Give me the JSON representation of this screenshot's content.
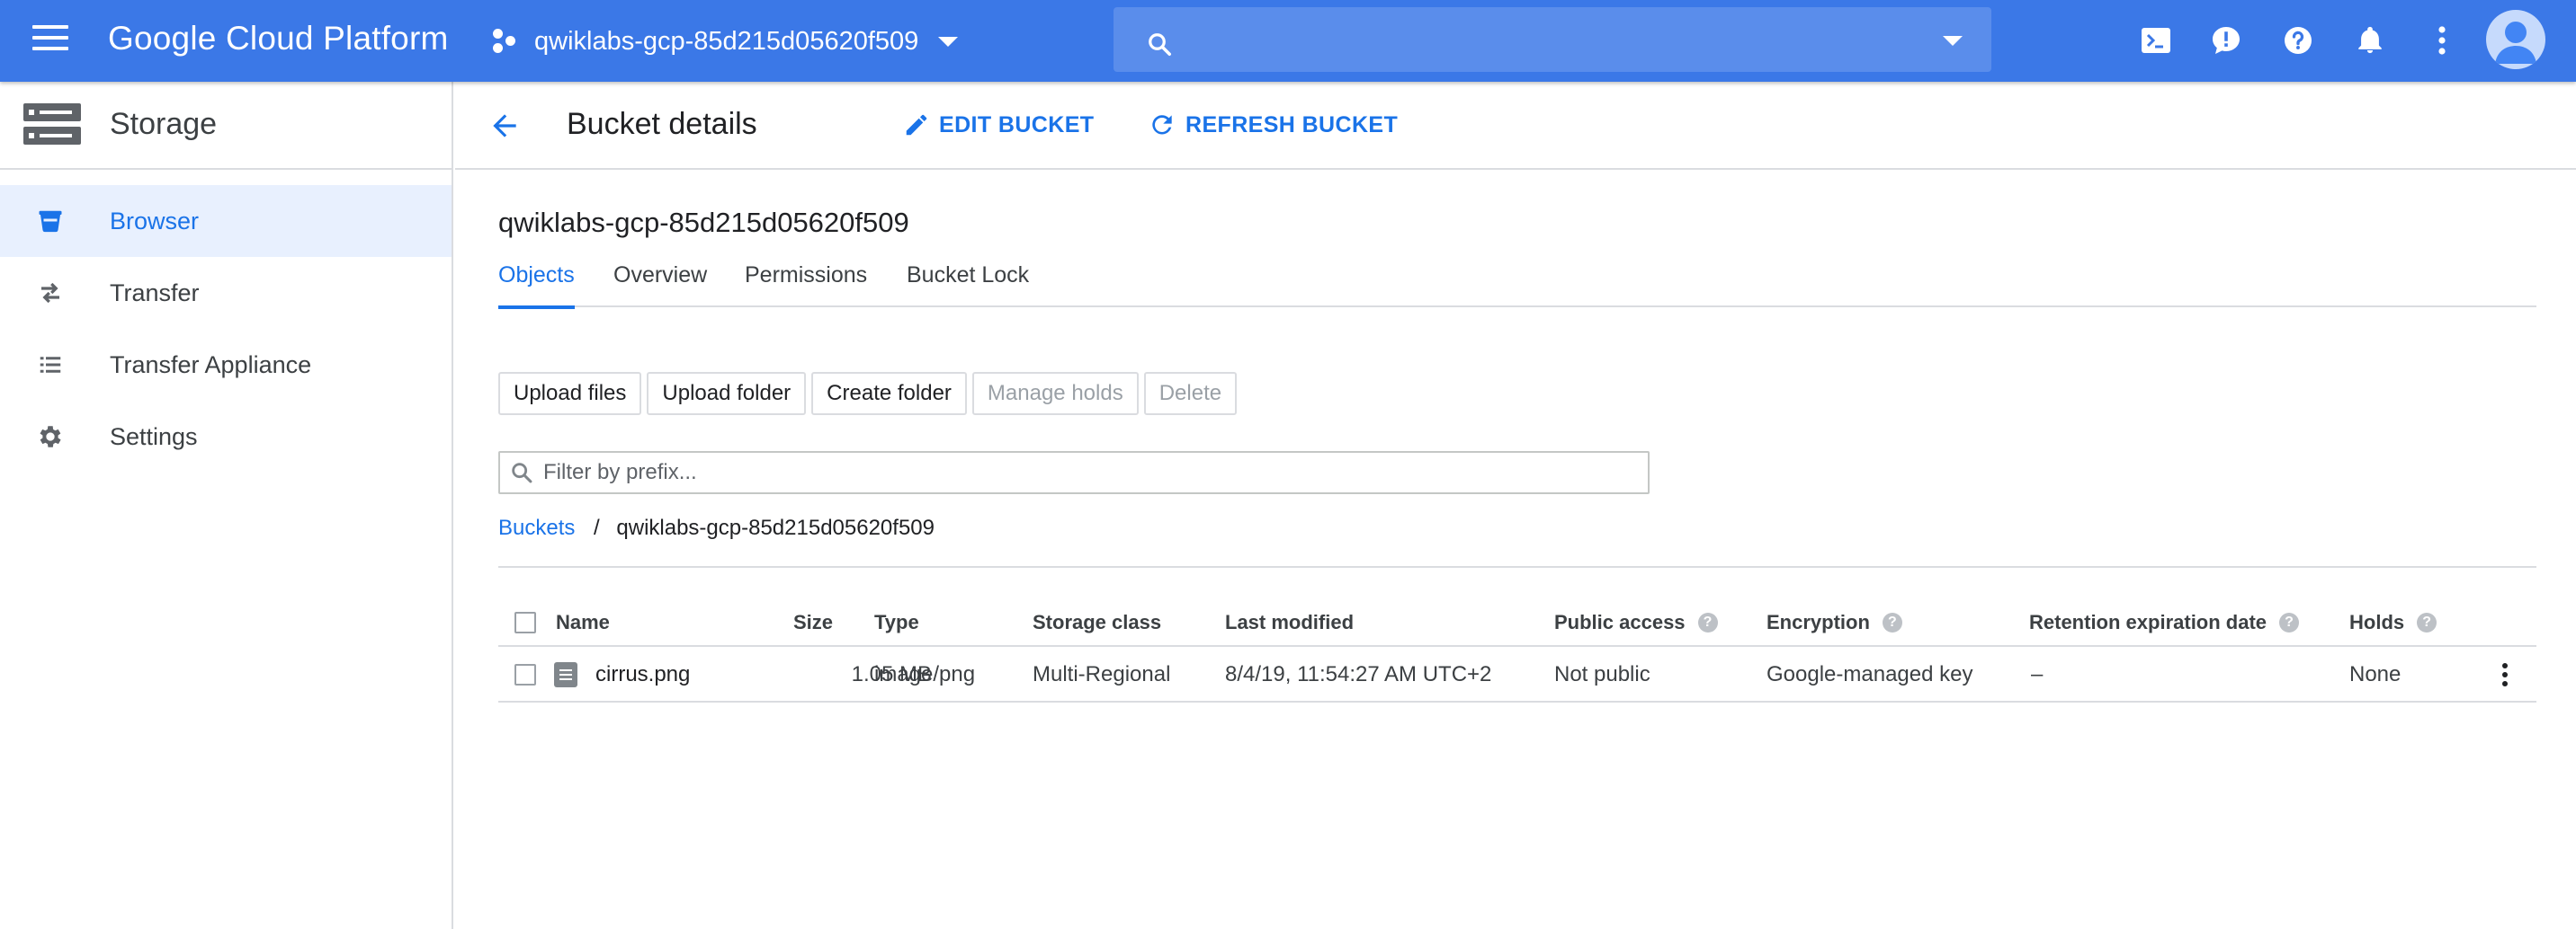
{
  "topbar": {
    "logo": "Google Cloud Platform",
    "project": "qwiklabs-gcp-85d215d05620f509",
    "search_placeholder": "",
    "icons": [
      "menu-icon",
      "project-icon",
      "search-icon",
      "cloud-shell-icon",
      "feedback-icon",
      "help-icon",
      "notifications-icon",
      "more-vert-icon",
      "account-icon"
    ]
  },
  "sidebar": {
    "title": "Storage",
    "items": [
      {
        "label": "Browser",
        "icon": "bucket-icon",
        "active": true
      },
      {
        "label": "Transfer",
        "icon": "transfer-icon"
      },
      {
        "label": "Transfer Appliance",
        "icon": "list-icon"
      },
      {
        "label": "Settings",
        "icon": "gear-icon"
      }
    ]
  },
  "header": {
    "title": "Bucket details",
    "edit_label": "EDIT BUCKET",
    "refresh_label": "REFRESH BUCKET"
  },
  "bucket": {
    "name": "qwiklabs-gcp-85d215d05620f509"
  },
  "tabs": [
    {
      "label": "Objects",
      "active": true
    },
    {
      "label": "Overview"
    },
    {
      "label": "Permissions"
    },
    {
      "label": "Bucket Lock"
    }
  ],
  "actions": {
    "upload_files": "Upload files",
    "upload_folder": "Upload folder",
    "create_folder": "Create folder",
    "manage_holds": "Manage holds",
    "delete": "Delete"
  },
  "filter": {
    "placeholder": "Filter by prefix...",
    "value": ""
  },
  "breadcrumb": {
    "root": "Buckets",
    "separator": "/",
    "current": "qwiklabs-gcp-85d215d05620f509"
  },
  "table": {
    "columns": {
      "name": "Name",
      "size": "Size",
      "type": "Type",
      "storage_class": "Storage class",
      "last_modified": "Last modified",
      "public_access": "Public access",
      "encryption": "Encryption",
      "retention": "Retention expiration date",
      "holds": "Holds"
    },
    "rows": [
      {
        "name": "cirrus.png",
        "size": "1.05 MB",
        "type": "image/png",
        "storage_class": "Multi-Regional",
        "last_modified": "8/4/19, 11:54:27 AM UTC+2",
        "public_access": "Not public",
        "encryption": "Google-managed key",
        "retention": "–",
        "holds": "None"
      }
    ]
  },
  "colors": {
    "topbar": "#3b78e7",
    "accent": "#1a73e8",
    "sidebar_active": "#e8f0fe",
    "divider": "#dadce0"
  }
}
